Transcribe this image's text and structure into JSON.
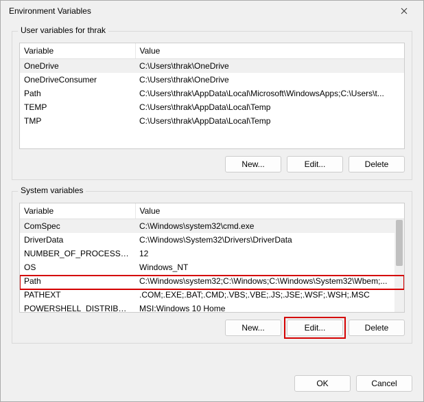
{
  "window": {
    "title": "Environment Variables"
  },
  "user_section": {
    "label": "User variables for thrak",
    "col_variable": "Variable",
    "col_value": "Value",
    "rows": [
      {
        "name": "OneDrive",
        "value": "C:\\Users\\thrak\\OneDrive"
      },
      {
        "name": "OneDriveConsumer",
        "value": "C:\\Users\\thrak\\OneDrive"
      },
      {
        "name": "Path",
        "value": "C:\\Users\\thrak\\AppData\\Local\\Microsoft\\WindowsApps;C:\\Users\\t..."
      },
      {
        "name": "TEMP",
        "value": "C:\\Users\\thrak\\AppData\\Local\\Temp"
      },
      {
        "name": "TMP",
        "value": "C:\\Users\\thrak\\AppData\\Local\\Temp"
      }
    ],
    "btn_new": "New...",
    "btn_edit": "Edit...",
    "btn_delete": "Delete"
  },
  "system_section": {
    "label": "System variables",
    "col_variable": "Variable",
    "col_value": "Value",
    "rows": [
      {
        "name": "ComSpec",
        "value": "C:\\Windows\\system32\\cmd.exe"
      },
      {
        "name": "DriverData",
        "value": "C:\\Windows\\System32\\Drivers\\DriverData"
      },
      {
        "name": "NUMBER_OF_PROCESSORS",
        "value": "12"
      },
      {
        "name": "OS",
        "value": "Windows_NT"
      },
      {
        "name": "Path",
        "value": "C:\\Windows\\system32;C:\\Windows;C:\\Windows\\System32\\Wbem;..."
      },
      {
        "name": "PATHEXT",
        "value": ".COM;.EXE;.BAT;.CMD;.VBS;.VBE;.JS;.JSE;.WSF;.WSH;.MSC"
      },
      {
        "name": "POWERSHELL_DISTRIBUTIO...",
        "value": "MSI:Windows 10 Home"
      }
    ],
    "btn_new": "New...",
    "btn_edit": "Edit...",
    "btn_delete": "Delete"
  },
  "footer": {
    "ok": "OK",
    "cancel": "Cancel"
  }
}
